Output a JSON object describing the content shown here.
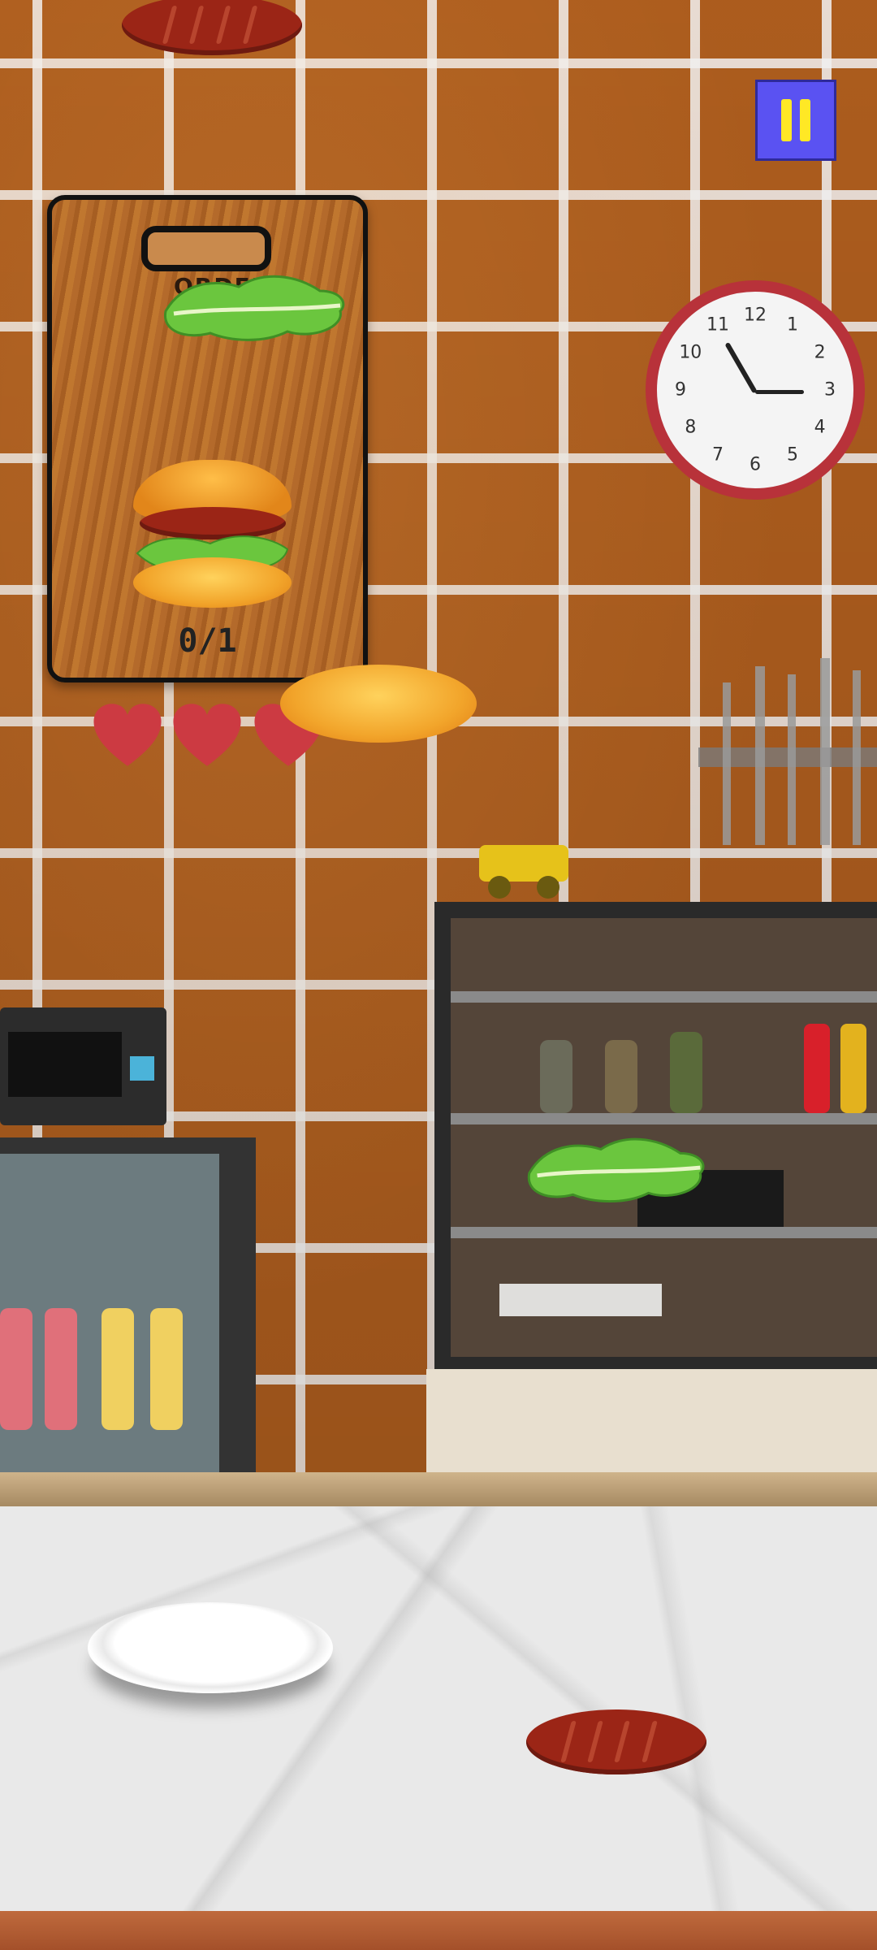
{
  "game": {
    "order_card": {
      "header_text": "ORDER",
      "progress": "0/1"
    },
    "lives": {
      "total": 3,
      "remaining": 3
    },
    "clock": {
      "numbers": [
        "12",
        "1",
        "2",
        "3",
        "4",
        "5",
        "6",
        "7",
        "8",
        "9",
        "10",
        "11"
      ]
    },
    "colors": {
      "pause_button": "#5a52f2",
      "pause_icon": "#ffe825",
      "heart": "#cc3a42",
      "wall": "#b5611f"
    },
    "icons": {
      "pause": "pause-icon",
      "heart": "heart-icon"
    }
  }
}
